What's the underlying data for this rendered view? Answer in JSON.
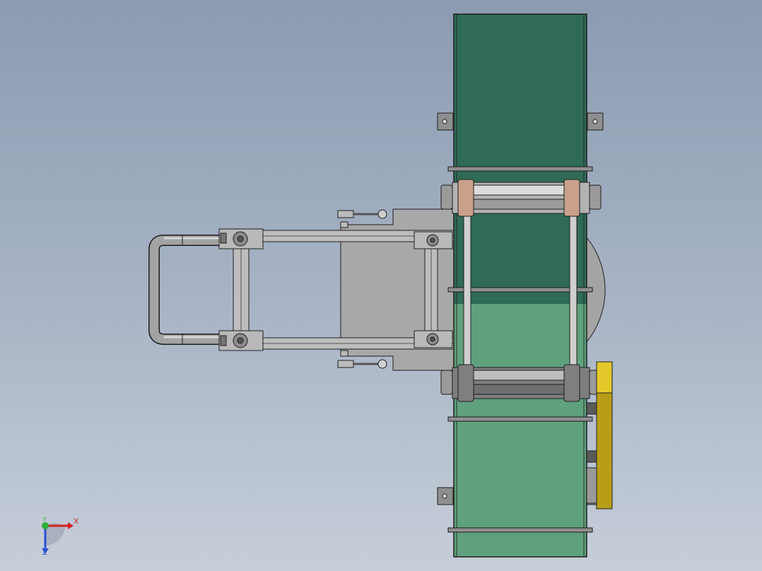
{
  "viewport": {
    "colors": {
      "background_top": "#8b9bb2",
      "background_bottom": "#c6ced9",
      "conveyor_upper": "#2f6b57",
      "conveyor_lower": "#5fa07d",
      "frame_gray": "#a8a8a8",
      "tube": "#9a9a9a",
      "bracket_yellow": "#e3c82a",
      "roller_tan": "#c9a089",
      "outline": "#1e1e1e"
    }
  },
  "triad": {
    "x_label": "X",
    "y_label": "Y",
    "z_label": "Z",
    "x_color": "#d42020",
    "y_color": "#2fae3a",
    "z_color": "#2a4fd4"
  }
}
